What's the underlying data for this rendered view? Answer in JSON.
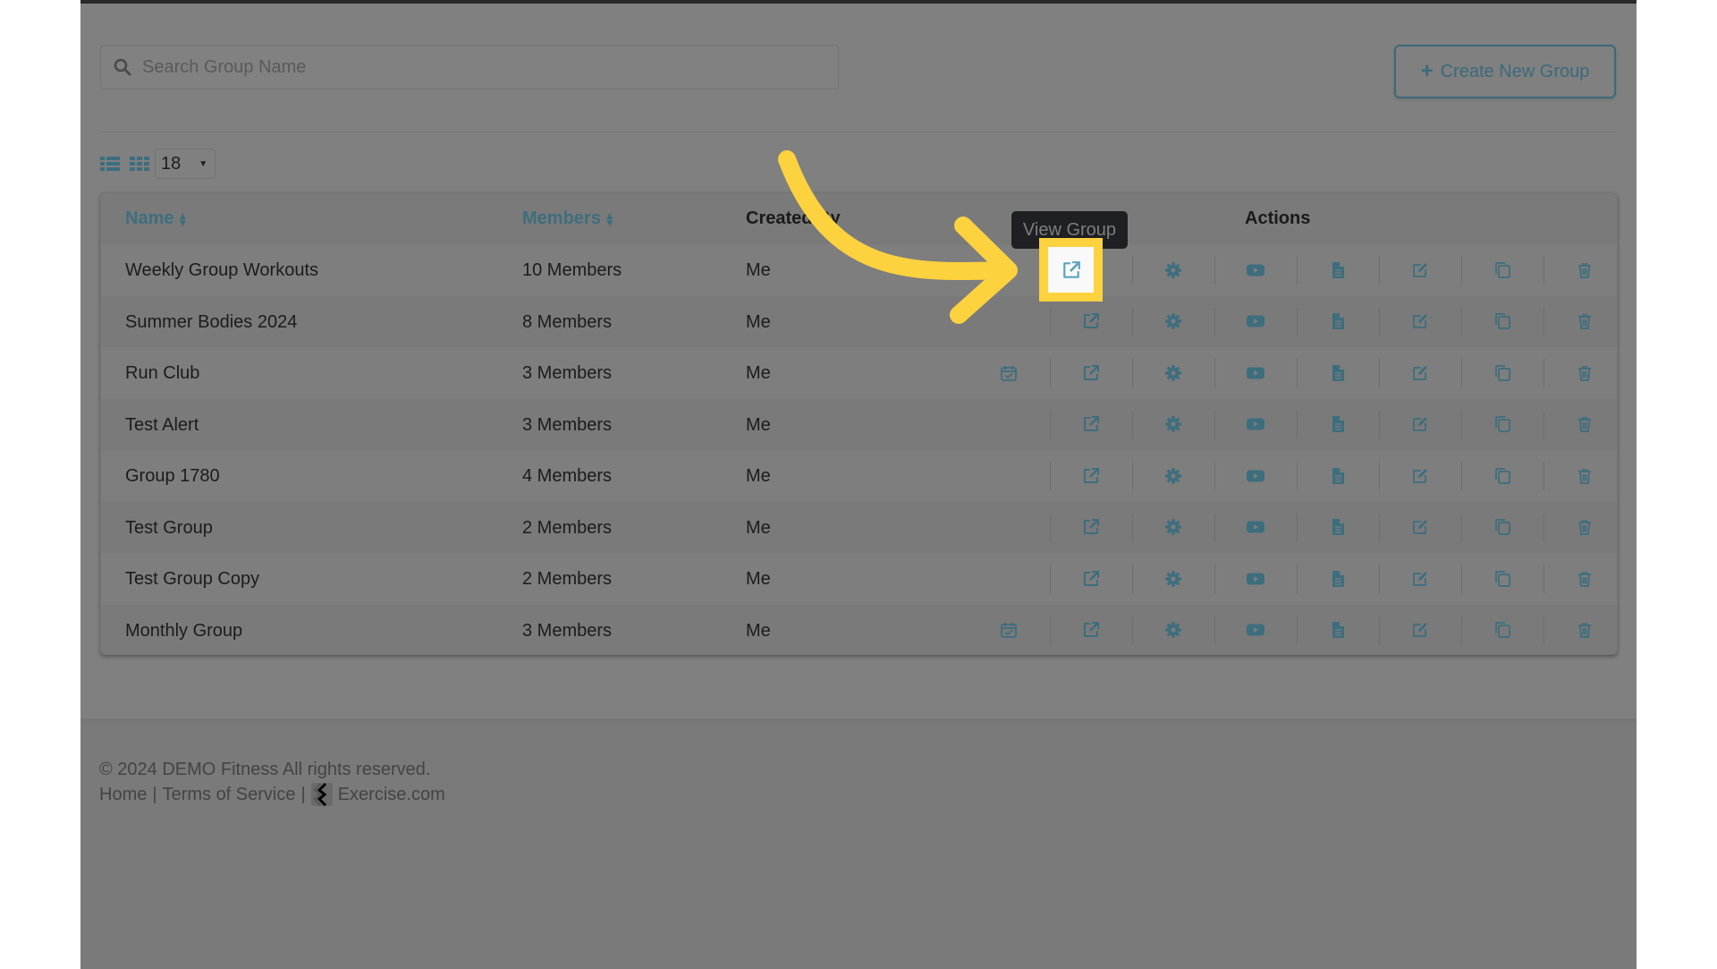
{
  "search": {
    "placeholder": "Search Group Name",
    "value": ""
  },
  "toolbar": {
    "create_label": "Create New Group",
    "per_page": "18"
  },
  "table": {
    "headers": {
      "name": "Name",
      "members": "Members",
      "created_by": "Created By",
      "actions": "Actions"
    },
    "rows": [
      {
        "name": "Weekly Group Workouts",
        "members": "10 Members",
        "created_by": "Me",
        "has_calendar": false
      },
      {
        "name": "Summer Bodies 2024",
        "members": "8 Members",
        "created_by": "Me",
        "has_calendar": false
      },
      {
        "name": "Run Club",
        "members": "3 Members",
        "created_by": "Me",
        "has_calendar": true
      },
      {
        "name": "Test Alert",
        "members": "3 Members",
        "created_by": "Me",
        "has_calendar": false
      },
      {
        "name": "Group 1780",
        "members": "4 Members",
        "created_by": "Me",
        "has_calendar": false
      },
      {
        "name": "Test Group",
        "members": "2 Members",
        "created_by": "Me",
        "has_calendar": false
      },
      {
        "name": "Test Group Copy",
        "members": "2 Members",
        "created_by": "Me",
        "has_calendar": false
      },
      {
        "name": "Monthly Group",
        "members": "3 Members",
        "created_by": "Me",
        "has_calendar": true
      }
    ],
    "action_icons": [
      "calendar-check-icon",
      "external-link-icon",
      "gear-icon",
      "youtube-icon",
      "file-text-icon",
      "edit-icon",
      "copy-icon",
      "trash-icon"
    ]
  },
  "tooltip": {
    "text": "View Group"
  },
  "footer": {
    "copyright": "© 2024 DEMO Fitness All rights reserved.",
    "home": "Home",
    "terms": "Terms of Service",
    "separator": "|",
    "brand": "Exercise.com"
  },
  "colors": {
    "accent": "#3d6e7e",
    "highlight": "#fdd23f",
    "overlay": "#808080"
  }
}
